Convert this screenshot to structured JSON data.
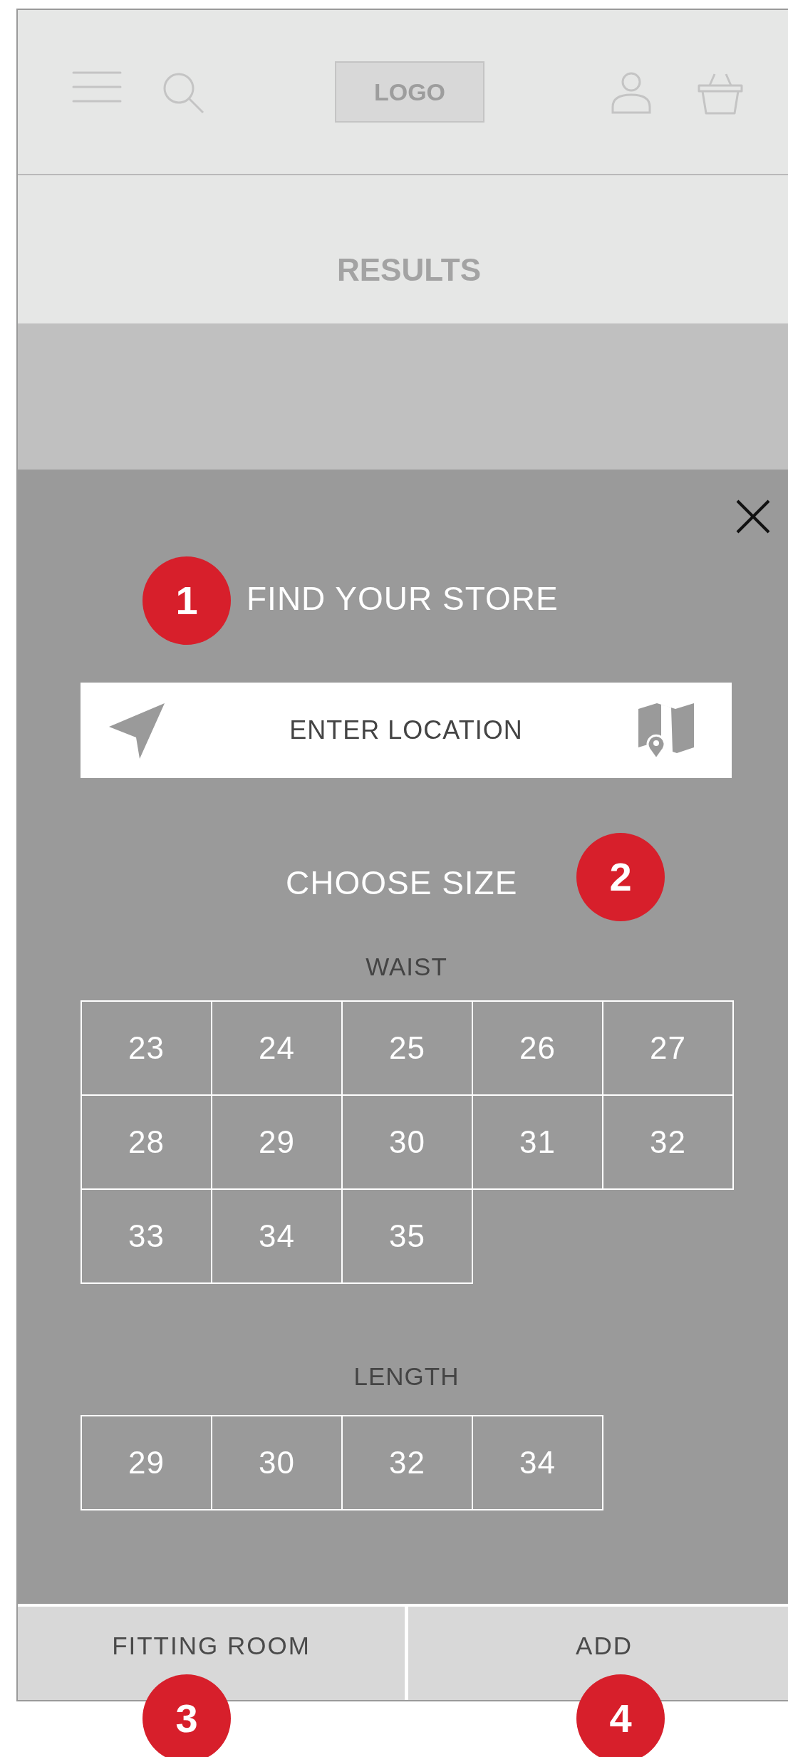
{
  "header": {
    "logo": "LOGO"
  },
  "results": {
    "title": "RESULTS"
  },
  "store_finder": {
    "badge": "1",
    "title": "FIND YOUR STORE",
    "location_field": {
      "placeholder": "ENTER LOCATION"
    }
  },
  "size_chooser": {
    "title": "CHOOSE SIZE",
    "badge": "2",
    "waist": {
      "label": "WAIST",
      "sizes": [
        "23",
        "24",
        "25",
        "26",
        "27",
        "28",
        "29",
        "30",
        "31",
        "32",
        "33",
        "34",
        "35"
      ]
    },
    "length": {
      "label": "LENGTH",
      "sizes": [
        "29",
        "30",
        "32",
        "34"
      ]
    }
  },
  "buttons": [
    {
      "label": "FITTING ROOM",
      "badge": "3"
    },
    {
      "label": "ADD",
      "badge": "4"
    }
  ]
}
